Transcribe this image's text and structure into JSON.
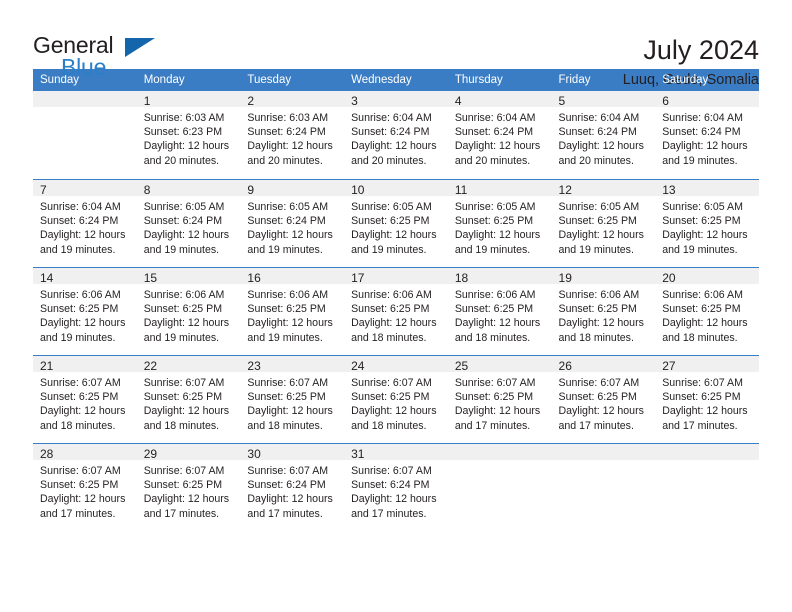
{
  "brand": {
    "word_one": "General",
    "word_two": "Blue",
    "accent_color": "#2a7fc9",
    "triangle_color": "#1565ad"
  },
  "header": {
    "title": "July 2024",
    "subtitle": "Luuq, Gedo, Somalia"
  },
  "theme": {
    "header_row_bg": "#3b7dc4",
    "daynum_bg": "#f0f0f0",
    "text_color": "#231f20"
  },
  "weekday_headers": [
    "Sunday",
    "Monday",
    "Tuesday",
    "Wednesday",
    "Thursday",
    "Friday",
    "Saturday"
  ],
  "weeks": [
    [
      {
        "day": "",
        "sunrise": "",
        "sunset": "",
        "daylight_1": "",
        "daylight_2": ""
      },
      {
        "day": "1",
        "sunrise": "Sunrise: 6:03 AM",
        "sunset": "Sunset: 6:23 PM",
        "daylight_1": "Daylight: 12 hours",
        "daylight_2": "and 20 minutes."
      },
      {
        "day": "2",
        "sunrise": "Sunrise: 6:03 AM",
        "sunset": "Sunset: 6:24 PM",
        "daylight_1": "Daylight: 12 hours",
        "daylight_2": "and 20 minutes."
      },
      {
        "day": "3",
        "sunrise": "Sunrise: 6:04 AM",
        "sunset": "Sunset: 6:24 PM",
        "daylight_1": "Daylight: 12 hours",
        "daylight_2": "and 20 minutes."
      },
      {
        "day": "4",
        "sunrise": "Sunrise: 6:04 AM",
        "sunset": "Sunset: 6:24 PM",
        "daylight_1": "Daylight: 12 hours",
        "daylight_2": "and 20 minutes."
      },
      {
        "day": "5",
        "sunrise": "Sunrise: 6:04 AM",
        "sunset": "Sunset: 6:24 PM",
        "daylight_1": "Daylight: 12 hours",
        "daylight_2": "and 20 minutes."
      },
      {
        "day": "6",
        "sunrise": "Sunrise: 6:04 AM",
        "sunset": "Sunset: 6:24 PM",
        "daylight_1": "Daylight: 12 hours",
        "daylight_2": "and 19 minutes."
      }
    ],
    [
      {
        "day": "7",
        "sunrise": "Sunrise: 6:04 AM",
        "sunset": "Sunset: 6:24 PM",
        "daylight_1": "Daylight: 12 hours",
        "daylight_2": "and 19 minutes."
      },
      {
        "day": "8",
        "sunrise": "Sunrise: 6:05 AM",
        "sunset": "Sunset: 6:24 PM",
        "daylight_1": "Daylight: 12 hours",
        "daylight_2": "and 19 minutes."
      },
      {
        "day": "9",
        "sunrise": "Sunrise: 6:05 AM",
        "sunset": "Sunset: 6:24 PM",
        "daylight_1": "Daylight: 12 hours",
        "daylight_2": "and 19 minutes."
      },
      {
        "day": "10",
        "sunrise": "Sunrise: 6:05 AM",
        "sunset": "Sunset: 6:25 PM",
        "daylight_1": "Daylight: 12 hours",
        "daylight_2": "and 19 minutes."
      },
      {
        "day": "11",
        "sunrise": "Sunrise: 6:05 AM",
        "sunset": "Sunset: 6:25 PM",
        "daylight_1": "Daylight: 12 hours",
        "daylight_2": "and 19 minutes."
      },
      {
        "day": "12",
        "sunrise": "Sunrise: 6:05 AM",
        "sunset": "Sunset: 6:25 PM",
        "daylight_1": "Daylight: 12 hours",
        "daylight_2": "and 19 minutes."
      },
      {
        "day": "13",
        "sunrise": "Sunrise: 6:05 AM",
        "sunset": "Sunset: 6:25 PM",
        "daylight_1": "Daylight: 12 hours",
        "daylight_2": "and 19 minutes."
      }
    ],
    [
      {
        "day": "14",
        "sunrise": "Sunrise: 6:06 AM",
        "sunset": "Sunset: 6:25 PM",
        "daylight_1": "Daylight: 12 hours",
        "daylight_2": "and 19 minutes."
      },
      {
        "day": "15",
        "sunrise": "Sunrise: 6:06 AM",
        "sunset": "Sunset: 6:25 PM",
        "daylight_1": "Daylight: 12 hours",
        "daylight_2": "and 19 minutes."
      },
      {
        "day": "16",
        "sunrise": "Sunrise: 6:06 AM",
        "sunset": "Sunset: 6:25 PM",
        "daylight_1": "Daylight: 12 hours",
        "daylight_2": "and 19 minutes."
      },
      {
        "day": "17",
        "sunrise": "Sunrise: 6:06 AM",
        "sunset": "Sunset: 6:25 PM",
        "daylight_1": "Daylight: 12 hours",
        "daylight_2": "and 18 minutes."
      },
      {
        "day": "18",
        "sunrise": "Sunrise: 6:06 AM",
        "sunset": "Sunset: 6:25 PM",
        "daylight_1": "Daylight: 12 hours",
        "daylight_2": "and 18 minutes."
      },
      {
        "day": "19",
        "sunrise": "Sunrise: 6:06 AM",
        "sunset": "Sunset: 6:25 PM",
        "daylight_1": "Daylight: 12 hours",
        "daylight_2": "and 18 minutes."
      },
      {
        "day": "20",
        "sunrise": "Sunrise: 6:06 AM",
        "sunset": "Sunset: 6:25 PM",
        "daylight_1": "Daylight: 12 hours",
        "daylight_2": "and 18 minutes."
      }
    ],
    [
      {
        "day": "21",
        "sunrise": "Sunrise: 6:07 AM",
        "sunset": "Sunset: 6:25 PM",
        "daylight_1": "Daylight: 12 hours",
        "daylight_2": "and 18 minutes."
      },
      {
        "day": "22",
        "sunrise": "Sunrise: 6:07 AM",
        "sunset": "Sunset: 6:25 PM",
        "daylight_1": "Daylight: 12 hours",
        "daylight_2": "and 18 minutes."
      },
      {
        "day": "23",
        "sunrise": "Sunrise: 6:07 AM",
        "sunset": "Sunset: 6:25 PM",
        "daylight_1": "Daylight: 12 hours",
        "daylight_2": "and 18 minutes."
      },
      {
        "day": "24",
        "sunrise": "Sunrise: 6:07 AM",
        "sunset": "Sunset: 6:25 PM",
        "daylight_1": "Daylight: 12 hours",
        "daylight_2": "and 18 minutes."
      },
      {
        "day": "25",
        "sunrise": "Sunrise: 6:07 AM",
        "sunset": "Sunset: 6:25 PM",
        "daylight_1": "Daylight: 12 hours",
        "daylight_2": "and 17 minutes."
      },
      {
        "day": "26",
        "sunrise": "Sunrise: 6:07 AM",
        "sunset": "Sunset: 6:25 PM",
        "daylight_1": "Daylight: 12 hours",
        "daylight_2": "and 17 minutes."
      },
      {
        "day": "27",
        "sunrise": "Sunrise: 6:07 AM",
        "sunset": "Sunset: 6:25 PM",
        "daylight_1": "Daylight: 12 hours",
        "daylight_2": "and 17 minutes."
      }
    ],
    [
      {
        "day": "28",
        "sunrise": "Sunrise: 6:07 AM",
        "sunset": "Sunset: 6:25 PM",
        "daylight_1": "Daylight: 12 hours",
        "daylight_2": "and 17 minutes."
      },
      {
        "day": "29",
        "sunrise": "Sunrise: 6:07 AM",
        "sunset": "Sunset: 6:25 PM",
        "daylight_1": "Daylight: 12 hours",
        "daylight_2": "and 17 minutes."
      },
      {
        "day": "30",
        "sunrise": "Sunrise: 6:07 AM",
        "sunset": "Sunset: 6:24 PM",
        "daylight_1": "Daylight: 12 hours",
        "daylight_2": "and 17 minutes."
      },
      {
        "day": "31",
        "sunrise": "Sunrise: 6:07 AM",
        "sunset": "Sunset: 6:24 PM",
        "daylight_1": "Daylight: 12 hours",
        "daylight_2": "and 17 minutes."
      },
      {
        "day": "",
        "sunrise": "",
        "sunset": "",
        "daylight_1": "",
        "daylight_2": ""
      },
      {
        "day": "",
        "sunrise": "",
        "sunset": "",
        "daylight_1": "",
        "daylight_2": ""
      },
      {
        "day": "",
        "sunrise": "",
        "sunset": "",
        "daylight_1": "",
        "daylight_2": ""
      }
    ]
  ]
}
